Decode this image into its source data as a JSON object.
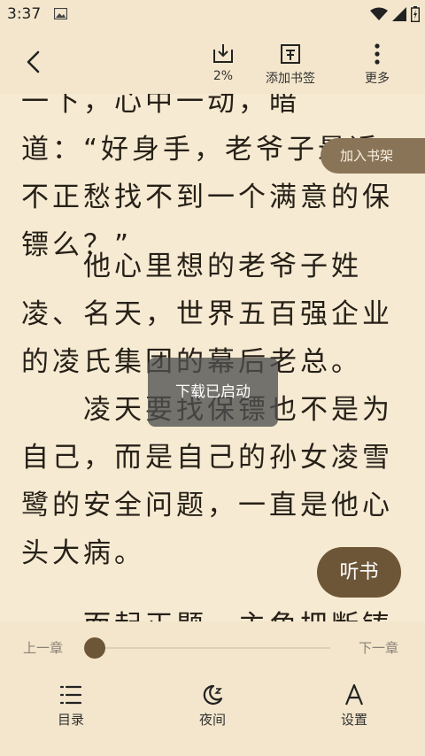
{
  "status": {
    "time": "3:37",
    "icons": [
      "gallery-icon",
      "wifi-icon",
      "signal-icon",
      "battery-icon"
    ]
  },
  "toolbar": {
    "back_icon": "back-arrow-icon",
    "download_label": "2%",
    "download_progress": 0.02,
    "bookmark_label": "添加书签",
    "more_label": "更多"
  },
  "content": {
    "paragraphs": [
      "一下，心中一动，暗道：“好身手，老爷子最近不正愁找不到一个满意的保镖么？”",
      "他心里想的老爷子姓凌、名天，世界五百强企业的凌氏集团的幕后老总。",
      "凌天要找保镖也不是为自己，而是自己的孙女凌雪鹭的安全问题，一直是他心头大病。",
      "而起正题，主角把断铸余"
    ]
  },
  "add_to_shelf": "加入书架",
  "toast": "下载已启动",
  "listen_button": "听书",
  "progress": {
    "prev_label": "上一章",
    "next_label": "下一章",
    "value": 0.0
  },
  "bottom_nav": [
    {
      "label": "目录",
      "icon": "catalog-icon"
    },
    {
      "label": "夜间",
      "icon": "night-mode-icon"
    },
    {
      "label": "设置",
      "icon": "settings-font-icon"
    }
  ],
  "colors": {
    "background": "#f6ead2",
    "bar": "#f3e6cc",
    "accent": "#6c5637",
    "shelf_button": "#8a7458"
  }
}
